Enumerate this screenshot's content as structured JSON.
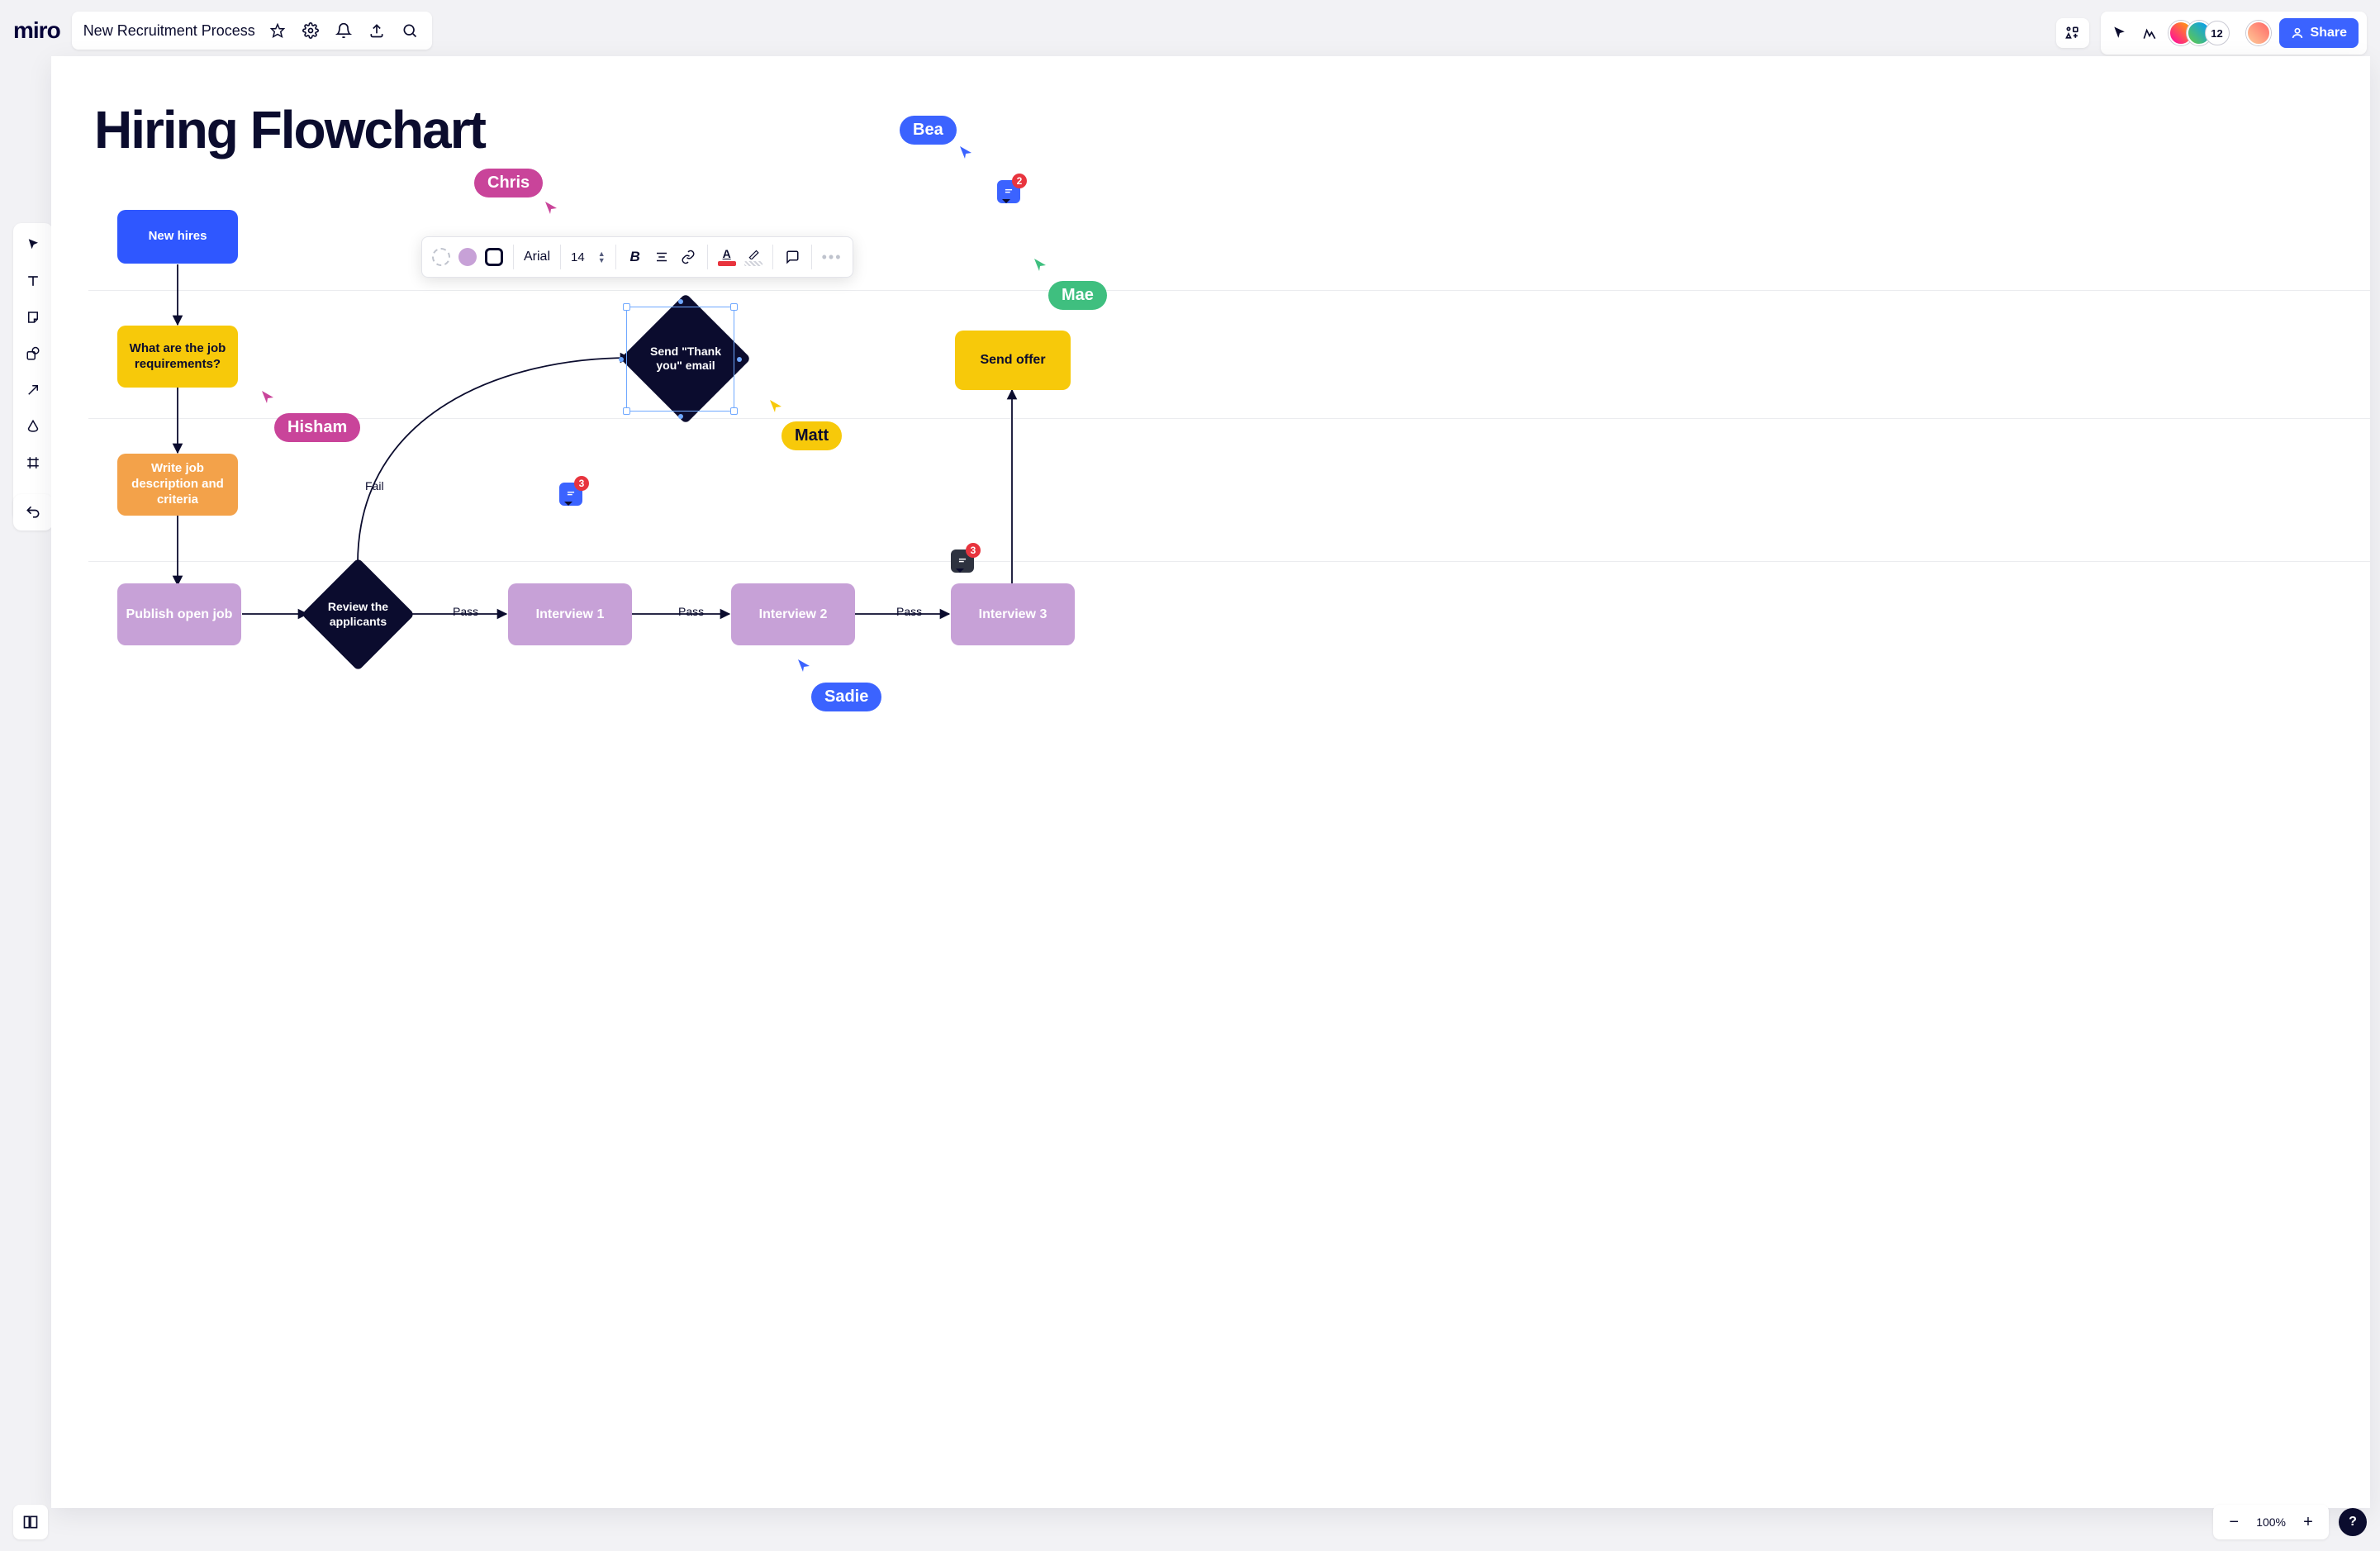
{
  "app": {
    "logo": "miro",
    "board_title": "New Recruitment Process"
  },
  "top_icons": {
    "settings": "settings-icon",
    "notifications": "bell-icon",
    "upload": "upload-icon",
    "search": "search-icon",
    "apps": "apps-icon",
    "pointer": "pointer-icon",
    "confetti": "confetti-icon"
  },
  "collaborators": {
    "overflow_count": "12"
  },
  "share": {
    "label": "Share"
  },
  "left_tools": [
    "select",
    "text",
    "sticky",
    "shape",
    "arrow",
    "pen",
    "frame",
    "more"
  ],
  "canvas": {
    "title": "Hiring Flowchart",
    "nodes": {
      "new_hires": "New hires",
      "requirements": "What are the job requirements?",
      "write_desc": "Write job description and criteria",
      "publish": "Publish open job",
      "review": "Review the applicants",
      "thank_you": "Send \"Thank you\" email",
      "interview1": "Interview 1",
      "interview2": "Interview 2",
      "interview3": "Interview 3",
      "send_offer": "Send offer"
    },
    "edge_labels": {
      "fail": "Fail",
      "pass1": "Pass",
      "pass2": "Pass",
      "pass3": "Pass"
    }
  },
  "context_toolbar": {
    "font": "Arial",
    "size": "14"
  },
  "cursors": {
    "chris": "Chris",
    "hisham": "Hisham",
    "matt": "Matt",
    "mae": "Mae",
    "bea": "Bea",
    "sadie": "Sadie"
  },
  "comments": {
    "c1": "3",
    "c2": "2",
    "c3": "3"
  },
  "zoom": {
    "level": "100%"
  },
  "help": {
    "label": "?"
  }
}
